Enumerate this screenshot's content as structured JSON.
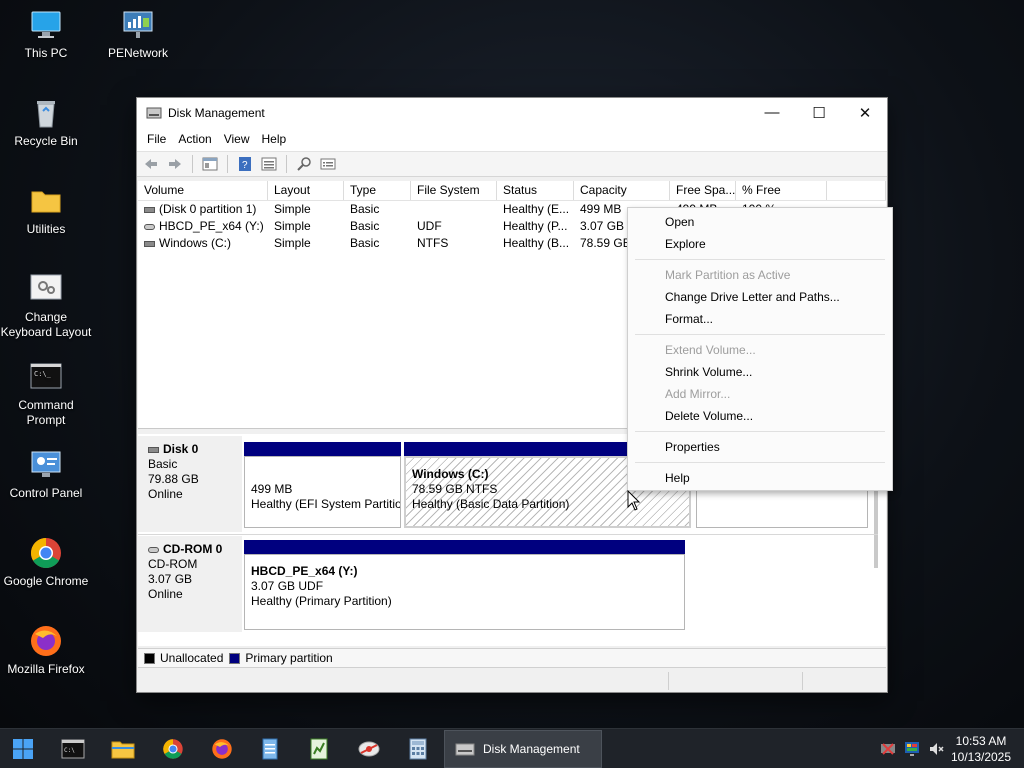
{
  "desktop": {
    "icons": [
      {
        "label": "This PC"
      },
      {
        "label": "PENetwork"
      },
      {
        "label": "Recycle Bin"
      },
      {
        "label": "Utilities"
      },
      {
        "label": "Change Keyboard Layout"
      },
      {
        "label": "Command Prompt"
      },
      {
        "label": "Control Panel"
      },
      {
        "label": "Google Chrome"
      },
      {
        "label": "Mozilla Firefox"
      }
    ]
  },
  "window": {
    "title": "Disk Management",
    "controls": {
      "minimize": "—",
      "maximize": "☐",
      "close": "✕"
    },
    "menu": [
      "File",
      "Action",
      "View",
      "Help"
    ],
    "toolbar_icons": [
      "back-icon",
      "forward-icon",
      "properties-icon",
      "help-icon",
      "details-icon",
      "search-icon",
      "list-icon"
    ]
  },
  "volume_table": {
    "columns": [
      "Volume",
      "Layout",
      "Type",
      "File System",
      "Status",
      "Capacity",
      "Free Spa...",
      "% Free",
      ""
    ],
    "rows": [
      {
        "volume": "(Disk 0 partition 1)",
        "layout": "Simple",
        "type": "Basic",
        "fs": "",
        "status": "Healthy (E...",
        "capacity": "499 MB",
        "free": "499 MB",
        "pct": "100 %"
      },
      {
        "volume": "HBCD_PE_x64 (Y:)",
        "layout": "Simple",
        "type": "Basic",
        "fs": "UDF",
        "status": "Healthy (P...",
        "capacity": "3.07 GB",
        "free": "",
        "pct": ""
      },
      {
        "volume": "Windows (C:)",
        "layout": "Simple",
        "type": "Basic",
        "fs": "NTFS",
        "status": "Healthy (B...",
        "capacity": "78.59 GB",
        "free": "",
        "pct": ""
      }
    ]
  },
  "disks": [
    {
      "name": "Disk 0",
      "kind": "Basic",
      "size": "79.88 GB",
      "state": "Online",
      "partitions": [
        {
          "name": "",
          "line1": "499 MB",
          "line2": "Healthy (EFI System Partitio"
        },
        {
          "name": "Windows  (C:)",
          "line1": "78.59 GB NTFS",
          "line2": "Healthy (Basic Data Partition)"
        }
      ]
    },
    {
      "name": "CD-ROM 0",
      "kind": "CD-ROM",
      "size": "3.07 GB",
      "state": "Online",
      "partitions": [
        {
          "name": "HBCD_PE_x64  (Y:)",
          "line1": "3.07 GB UDF",
          "line2": "Healthy (Primary Partition)"
        }
      ]
    }
  ],
  "legend": [
    {
      "label": "Unallocated",
      "color": "#000000"
    },
    {
      "label": "Primary partition",
      "color": "#00007f"
    }
  ],
  "context_menu": {
    "groups": [
      [
        {
          "label": "Open",
          "enabled": true
        },
        {
          "label": "Explore",
          "enabled": true
        }
      ],
      [
        {
          "label": "Mark Partition as Active",
          "enabled": false
        },
        {
          "label": "Change Drive Letter and Paths...",
          "enabled": true
        },
        {
          "label": "Format...",
          "enabled": true
        }
      ],
      [
        {
          "label": "Extend Volume...",
          "enabled": false
        },
        {
          "label": "Shrink Volume...",
          "enabled": true
        },
        {
          "label": "Add Mirror...",
          "enabled": false
        },
        {
          "label": "Delete Volume...",
          "enabled": true
        }
      ],
      [
        {
          "label": "Properties",
          "enabled": true
        }
      ],
      [
        {
          "label": "Help",
          "enabled": true
        }
      ]
    ]
  },
  "taskbar": {
    "active_app": "Disk Management",
    "pinned": [
      "start-icon",
      "terminal-icon",
      "file-explorer-icon",
      "chrome-icon",
      "firefox-icon",
      "notepad-icon",
      "spreadsheet-icon",
      "network-tool-icon",
      "calculator-icon"
    ],
    "clock": {
      "time": "10:53 AM",
      "date": "10/13/2025"
    }
  },
  "colors": {
    "primary_partition": "#00007f",
    "taskbar": "#1f2329"
  }
}
